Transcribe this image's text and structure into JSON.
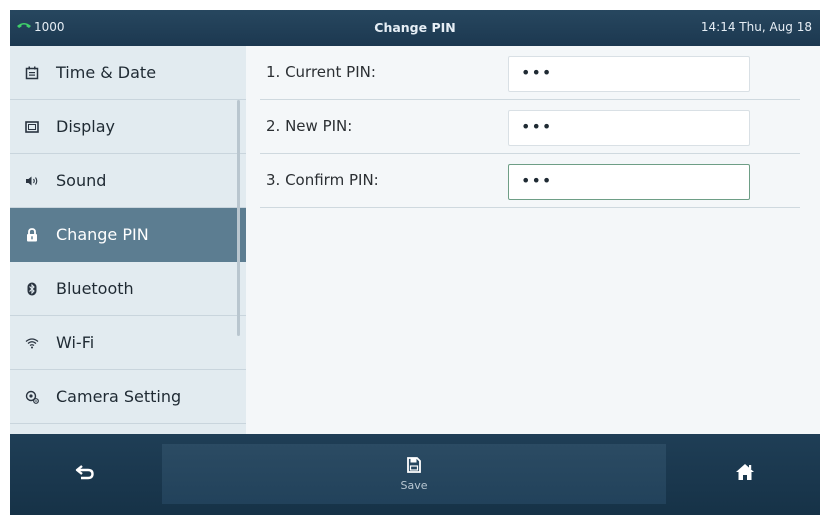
{
  "topbar": {
    "account": "1000",
    "title": "Change PIN",
    "datetime": "14:14 Thu, Aug 18"
  },
  "sidebar": {
    "items": [
      {
        "label": "Time & Date",
        "icon": "calendar-icon"
      },
      {
        "label": "Display",
        "icon": "display-icon"
      },
      {
        "label": "Sound",
        "icon": "speaker-icon"
      },
      {
        "label": "Change PIN",
        "icon": "lock-icon",
        "active": true
      },
      {
        "label": "Bluetooth",
        "icon": "bluetooth-icon"
      },
      {
        "label": "Wi-Fi",
        "icon": "wifi-icon"
      },
      {
        "label": "Camera Setting",
        "icon": "camera-icon"
      }
    ]
  },
  "form": {
    "rows": [
      {
        "label": "1. Current PIN:",
        "value": "•••"
      },
      {
        "label": "2. New PIN:",
        "value": "•••"
      },
      {
        "label": "3. Confirm PIN:",
        "value": "•••",
        "focused": true
      }
    ]
  },
  "bottombar": {
    "back_icon": "back-arrow-icon",
    "save_label": "Save",
    "save_icon": "save-icon",
    "home_icon": "home-icon"
  },
  "colors": {
    "bar": "#1b3a54",
    "active_item": "#5c7d91",
    "sidebar": "#e2ebf0",
    "panel": "#f4f7f9",
    "focus_border": "#6e9e86"
  }
}
